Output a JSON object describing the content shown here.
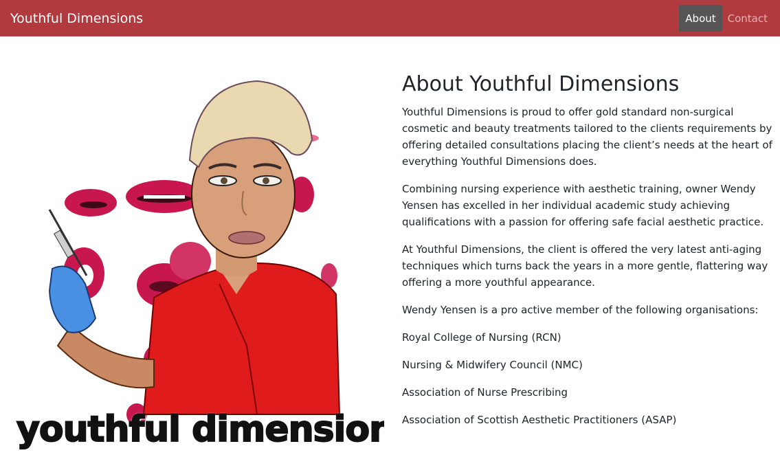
{
  "navbar": {
    "brand": "Youthful Dimensions",
    "links": [
      {
        "label": "About",
        "active": true
      },
      {
        "label": "Contact",
        "active": false
      }
    ],
    "bg_color": "#b03a3e",
    "active_bg_color": "#555555"
  },
  "hero": {
    "logo_text": "youthful dimensions"
  },
  "about": {
    "title": "About Youthful Dimensions",
    "paragraphs": [
      "Youthful Dimensions is proud to offer gold standard non-surgical cosmetic and beauty treatments tailored to the clients requirements by offering detailed consultations placing the client’s needs at the heart of everything Youthful Dimensions does.",
      "Combining nursing experience with aesthetic training, owner Wendy Yensen has excelled in her individual academic study achieving qualifications with a passion for offering safe facial aesthetic practice.",
      "At Youthful Dimensions, the client is offered the very latest anti-aging techniques which turns back the years in a more gentle, flattering way offering a more youthful appearance.",
      "Wendy Yensen is a pro active member of the following organisations:",
      "Royal College of Nursing (RCN)",
      "Nursing & Midwifery Council (NMC)",
      "Association of Nurse Prescribing",
      "Association of Scottish Aesthetic Practitioners (ASAP)"
    ]
  }
}
